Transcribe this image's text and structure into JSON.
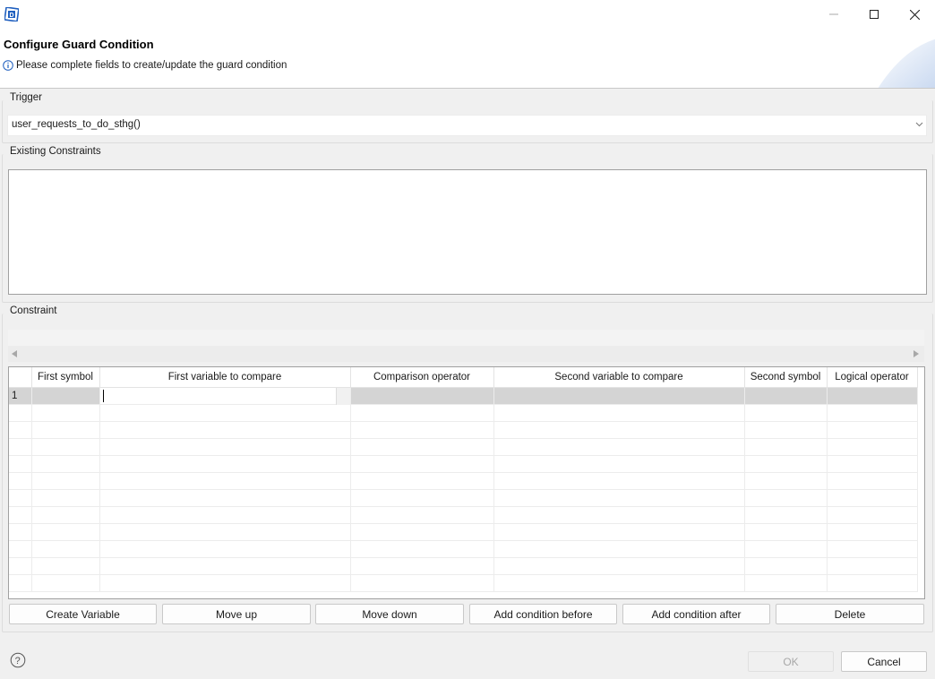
{
  "dialog": {
    "title": "Configure Guard Condition",
    "message": "Please complete fields to create/update the guard condition",
    "info_icon": "info-icon",
    "app_icon": "app-logo-icon"
  },
  "window_controls": {
    "minimize": "—",
    "maximize": "☐",
    "close": "✕"
  },
  "trigger": {
    "legend": "Trigger",
    "selected_value": "user_requests_to_do_sthg()"
  },
  "existing_constraints": {
    "legend": "Existing Constraints"
  },
  "constraint": {
    "legend": "Constraint",
    "columns": [
      "",
      "First symbol",
      "First variable to compare",
      "Comparison operator",
      "Second variable to compare",
      "Second symbol",
      "Logical operator"
    ],
    "rows": [
      {
        "num": "1",
        "first_symbol": "",
        "first_variable": "",
        "comparison_operator": "",
        "second_variable": "",
        "second_symbol": "",
        "logical_operator": ""
      }
    ],
    "buttons": {
      "create_variable": "Create Variable",
      "move_up": "Move up",
      "move_down": "Move down",
      "add_before": "Add condition before",
      "add_after": "Add condition after",
      "delete": "Delete"
    }
  },
  "footer": {
    "ok": "OK",
    "cancel": "Cancel",
    "ok_enabled": false
  },
  "colors": {
    "selected_row": "#d4d4d4",
    "brand_icon": "#1f5fbf"
  }
}
